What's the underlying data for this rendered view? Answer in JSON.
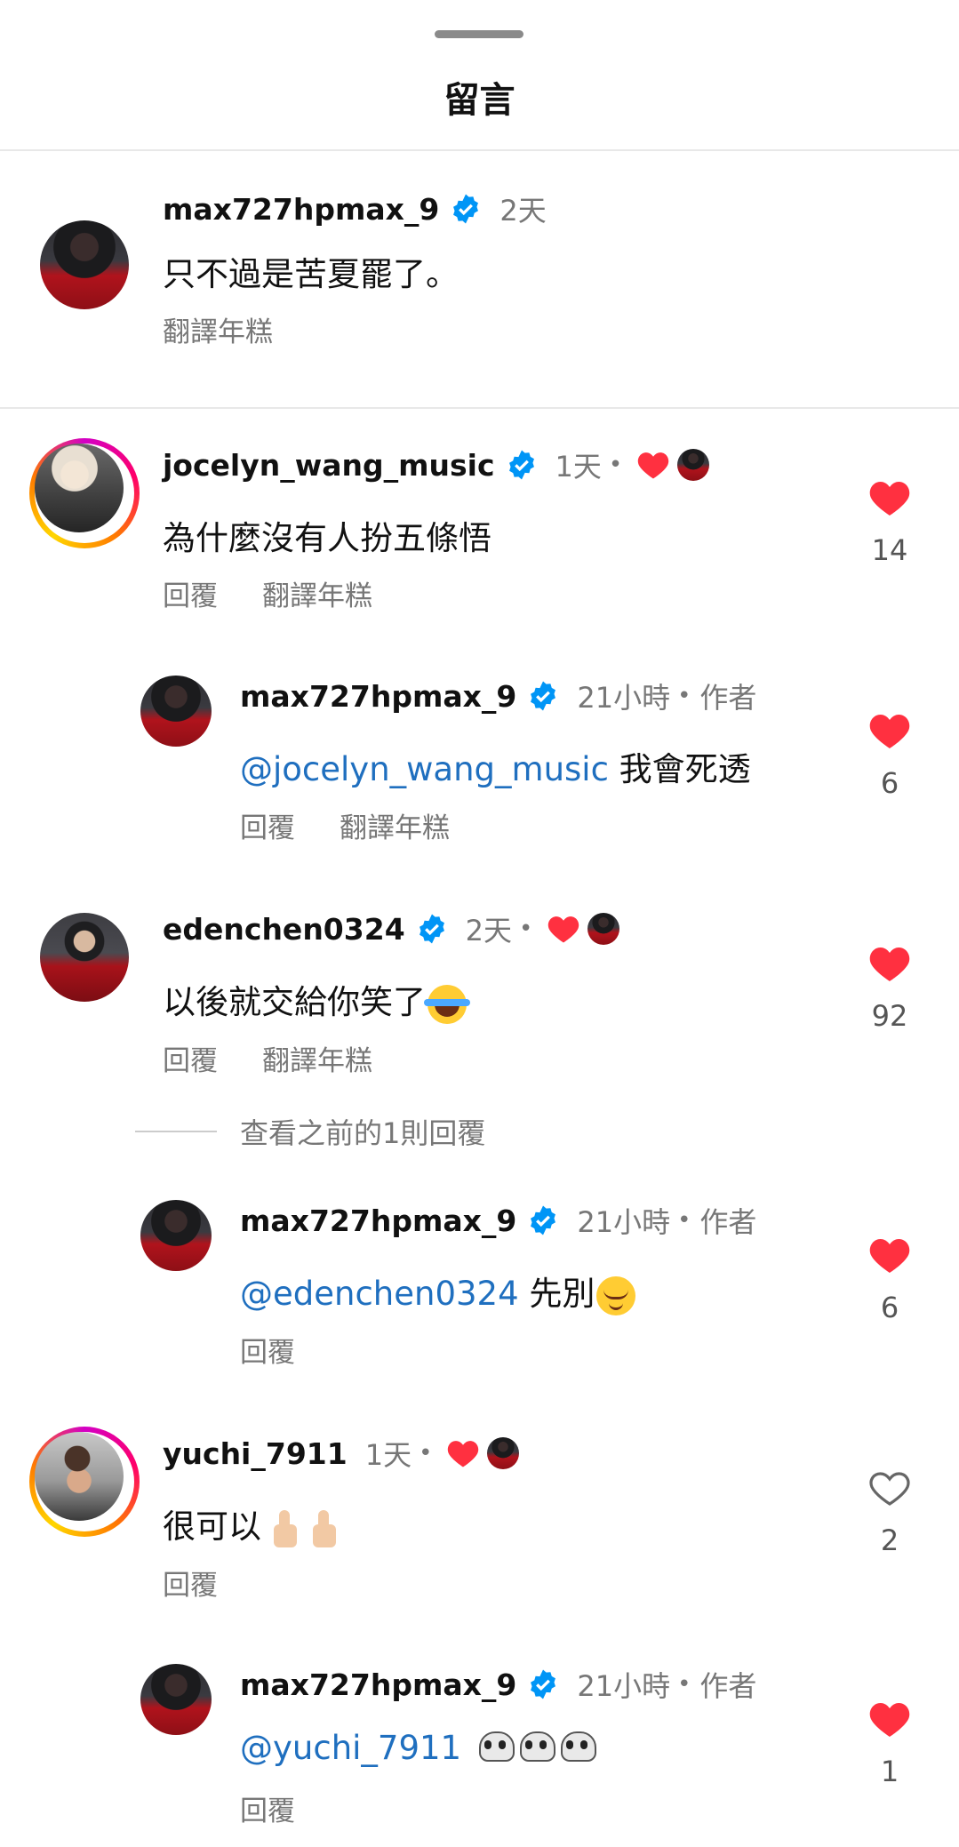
{
  "header": {
    "title": "留言"
  },
  "icons": {
    "verified": "verified-badge-icon",
    "heart_filled": "heart-filled-icon",
    "heart_outline": "heart-outline-icon"
  },
  "colors": {
    "like_red": "#ff3040",
    "verified_blue": "#0095f6",
    "mention_blue": "#1f6fbf"
  },
  "caption": {
    "username": "max727hpmax_9",
    "time": "2天",
    "text": "只不過是苦夏罷了。",
    "translate": "翻譯年糕"
  },
  "comments": [
    {
      "username": "jocelyn_wang_music",
      "time": "1天",
      "dot": "•",
      "text": "為什麼沒有人扮五條悟",
      "reply": "回覆",
      "translate": "翻譯年糕",
      "likes": "14",
      "liked": true,
      "liked_by_author": true
    },
    {
      "username": "max727hpmax_9",
      "time": "21小時",
      "dot": "•",
      "author": "作者",
      "mention": "@jocelyn_wang_music",
      "text": " 我會死透",
      "reply": "回覆",
      "translate": "翻譯年糕",
      "likes": "6",
      "liked": true
    },
    {
      "username": "edenchen0324",
      "time": "2天",
      "dot": "•",
      "text": "以後就交給你笑了",
      "emoji": "face-with-tears-of-joy",
      "reply": "回覆",
      "translate": "翻譯年糕",
      "likes": "92",
      "liked": true,
      "liked_by_author": true
    },
    {
      "username": "max727hpmax_9",
      "time": "21小時",
      "dot": "•",
      "author": "作者",
      "mention": "@edenchen0324",
      "text": " 先別",
      "emoji": "relieved-face",
      "reply": "回覆",
      "likes": "6",
      "liked": true
    },
    {
      "username": "yuchi_7911",
      "time": "1天",
      "dot": "•",
      "text": "很可以",
      "emoji": "thumbs-up x2",
      "reply": "回覆",
      "likes": "2",
      "liked": false,
      "liked_by_author": true
    },
    {
      "username": "max727hpmax_9",
      "time": "21小時",
      "dot": "•",
      "author": "作者",
      "mention": "@yuchi_7911",
      "text": " ",
      "emoji": "skull x3",
      "reply": "回覆",
      "likes": "1",
      "liked": true
    }
  ],
  "view_more": "查看之前的1則回覆"
}
